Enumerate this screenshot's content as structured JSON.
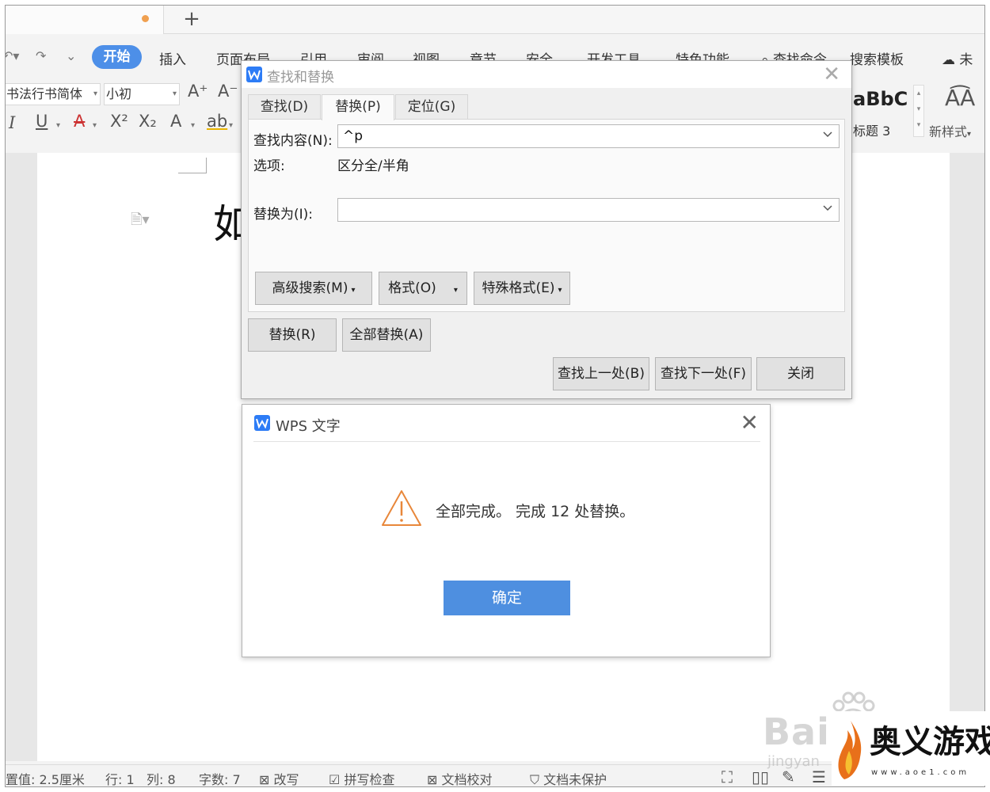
{
  "app": {
    "tab_unsaved_color": "#f0a050",
    "new_tab_label": "+",
    "menu": {
      "start": "开始",
      "items": [
        "插入",
        "页面布局",
        "引用",
        "审阅",
        "视图",
        "章节",
        "安全",
        "开发工具",
        "特色功能"
      ],
      "find_command": "查找命令",
      "search_template": "搜索模板",
      "sync_status": "未"
    },
    "toolbar": {
      "font_name": "书法行书简体",
      "font_size": "小初",
      "grow_font": "A⁺",
      "shrink_font": "A⁻",
      "italic": "I",
      "underline": "U",
      "strikethrough": "A",
      "superscript": "X²",
      "subscript": "X₂",
      "text_effect": "A",
      "highlight": "ab",
      "style_preview": "aBbC",
      "style_label": "标题 3",
      "new_style_label": "新样式"
    },
    "document": {
      "text": "如／"
    },
    "statusbar": {
      "position": "置值: 2.5厘米",
      "row": "行: 1",
      "col": "列: 8",
      "word_count": "字数: 7",
      "overwrite": "改写",
      "spell_check": "拼写检查",
      "proofread": "文档校对",
      "protection": "文档未保护"
    }
  },
  "find_replace": {
    "title": "查找和替换",
    "tabs": [
      {
        "label": "查找(D)",
        "active": false
      },
      {
        "label": "替换(P)",
        "active": true
      },
      {
        "label": "定位(G)",
        "active": false
      }
    ],
    "find_label": "查找内容(N):",
    "find_value": "^p",
    "options_label": "选项:",
    "options_value": "区分全/半角",
    "replace_label": "替换为(I):",
    "replace_value": "",
    "advanced_search": "高级搜索(M)",
    "format": "格式(O)",
    "special_format": "特殊格式(E)",
    "replace_button": "替换(R)",
    "replace_all_button": "全部替换(A)",
    "find_prev": "查找上一处(B)",
    "find_next": "查找下一处(F)",
    "close": "关闭"
  },
  "message_box": {
    "title": "WPS 文字",
    "message": "全部完成。 完成 12 处替换。",
    "ok": "确定",
    "warning_color": "#e8873a",
    "ok_color": "#4e8fe0"
  },
  "watermark": {
    "baidu": "Bai",
    "jingyan": "jingyan",
    "site_name": "奥义游戏网",
    "site_url": "www.aoe1.com"
  }
}
